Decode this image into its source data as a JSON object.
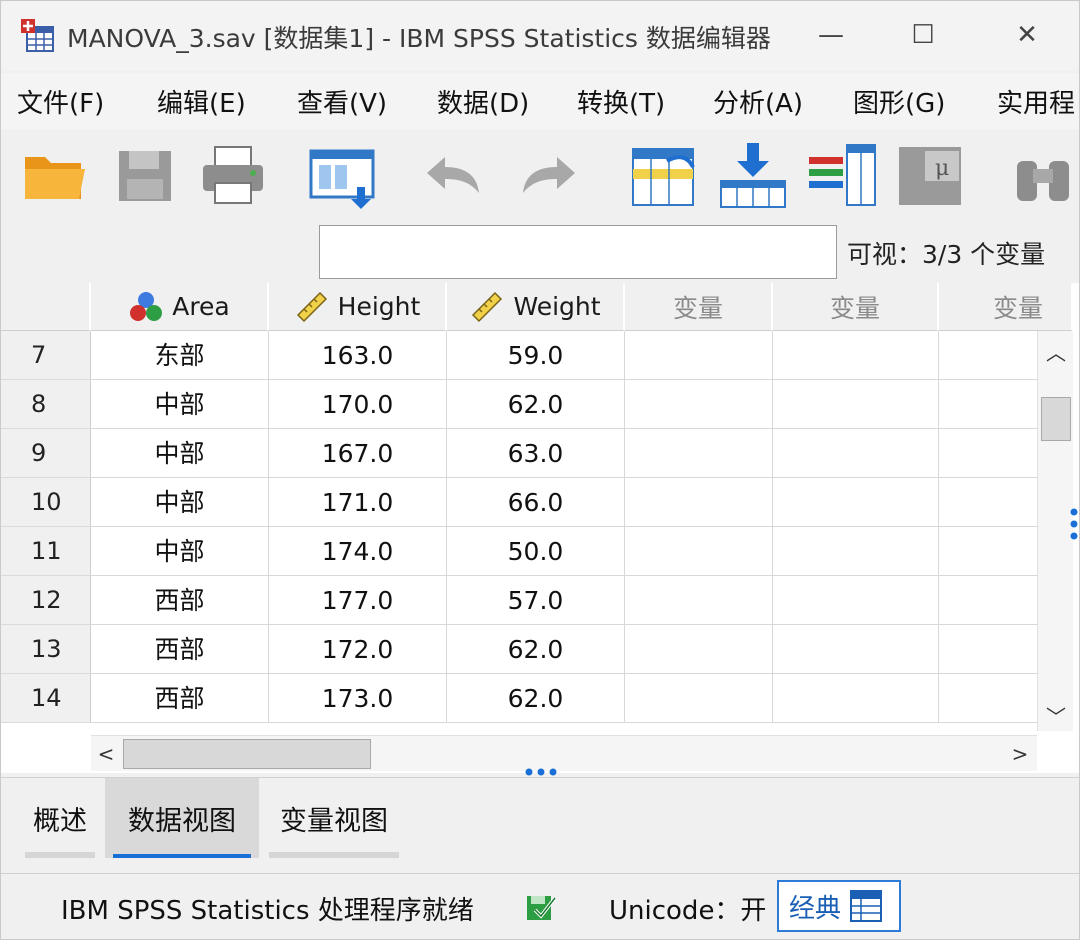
{
  "window": {
    "title": "MANOVA_3.sav [数据集1] - IBM SPSS Statistics 数据编辑器",
    "minimize": "—",
    "maximize": "☐",
    "close": "✕"
  },
  "menu": [
    {
      "label": "文件(F)"
    },
    {
      "label": "编辑(E)"
    },
    {
      "label": "查看(V)"
    },
    {
      "label": "数据(D)"
    },
    {
      "label": "转换(T)"
    },
    {
      "label": "分析(A)"
    },
    {
      "label": "图形(G)"
    },
    {
      "label": "实用程"
    }
  ],
  "toolbar": {
    "icons": [
      "folder-open-icon",
      "save-icon",
      "print-icon",
      "dialog-recall-icon",
      "undo-icon",
      "redo-icon",
      "goto-case-icon",
      "goto-variable-icon",
      "variables-icon",
      "value-labels-icon",
      "find-icon"
    ]
  },
  "edit_strip": {
    "cell_value": "",
    "visible": "可视：3/3 个变量"
  },
  "grid": {
    "columns": [
      {
        "label": "Area",
        "icon": "nominal-icon"
      },
      {
        "label": "Height",
        "icon": "scale-ruler-icon"
      },
      {
        "label": "Weight",
        "icon": "scale-ruler-icon"
      },
      {
        "label": "变量",
        "icon": ""
      },
      {
        "label": "变量",
        "icon": ""
      },
      {
        "label": "变量",
        "icon": ""
      }
    ],
    "rows": [
      {
        "num": "7",
        "area": "东部",
        "height": "163.0",
        "weight": "59.0"
      },
      {
        "num": "8",
        "area": "中部",
        "height": "170.0",
        "weight": "62.0"
      },
      {
        "num": "9",
        "area": "中部",
        "height": "167.0",
        "weight": "63.0"
      },
      {
        "num": "10",
        "area": "中部",
        "height": "171.0",
        "weight": "66.0"
      },
      {
        "num": "11",
        "area": "中部",
        "height": "174.0",
        "weight": "50.0"
      },
      {
        "num": "12",
        "area": "西部",
        "height": "177.0",
        "weight": "57.0"
      },
      {
        "num": "13",
        "area": "西部",
        "height": "172.0",
        "weight": "62.0"
      },
      {
        "num": "14",
        "area": "西部",
        "height": "173.0",
        "weight": "62.0"
      }
    ],
    "scroll_up": "︿",
    "scroll_down": "﹀",
    "scroll_left": "<",
    "scroll_right": ">"
  },
  "tabs": [
    {
      "label": "概述",
      "active": false
    },
    {
      "label": "数据视图",
      "active": true
    },
    {
      "label": "变量视图",
      "active": false
    }
  ],
  "status": {
    "processor": "IBM SPSS Statistics 处理程序就绪",
    "unicode": "Unicode：开",
    "classic": "经典"
  },
  "colors": {
    "accent": "#1a6fd6",
    "header_bg": "#f0f0f0",
    "folder": "#f5a623"
  }
}
